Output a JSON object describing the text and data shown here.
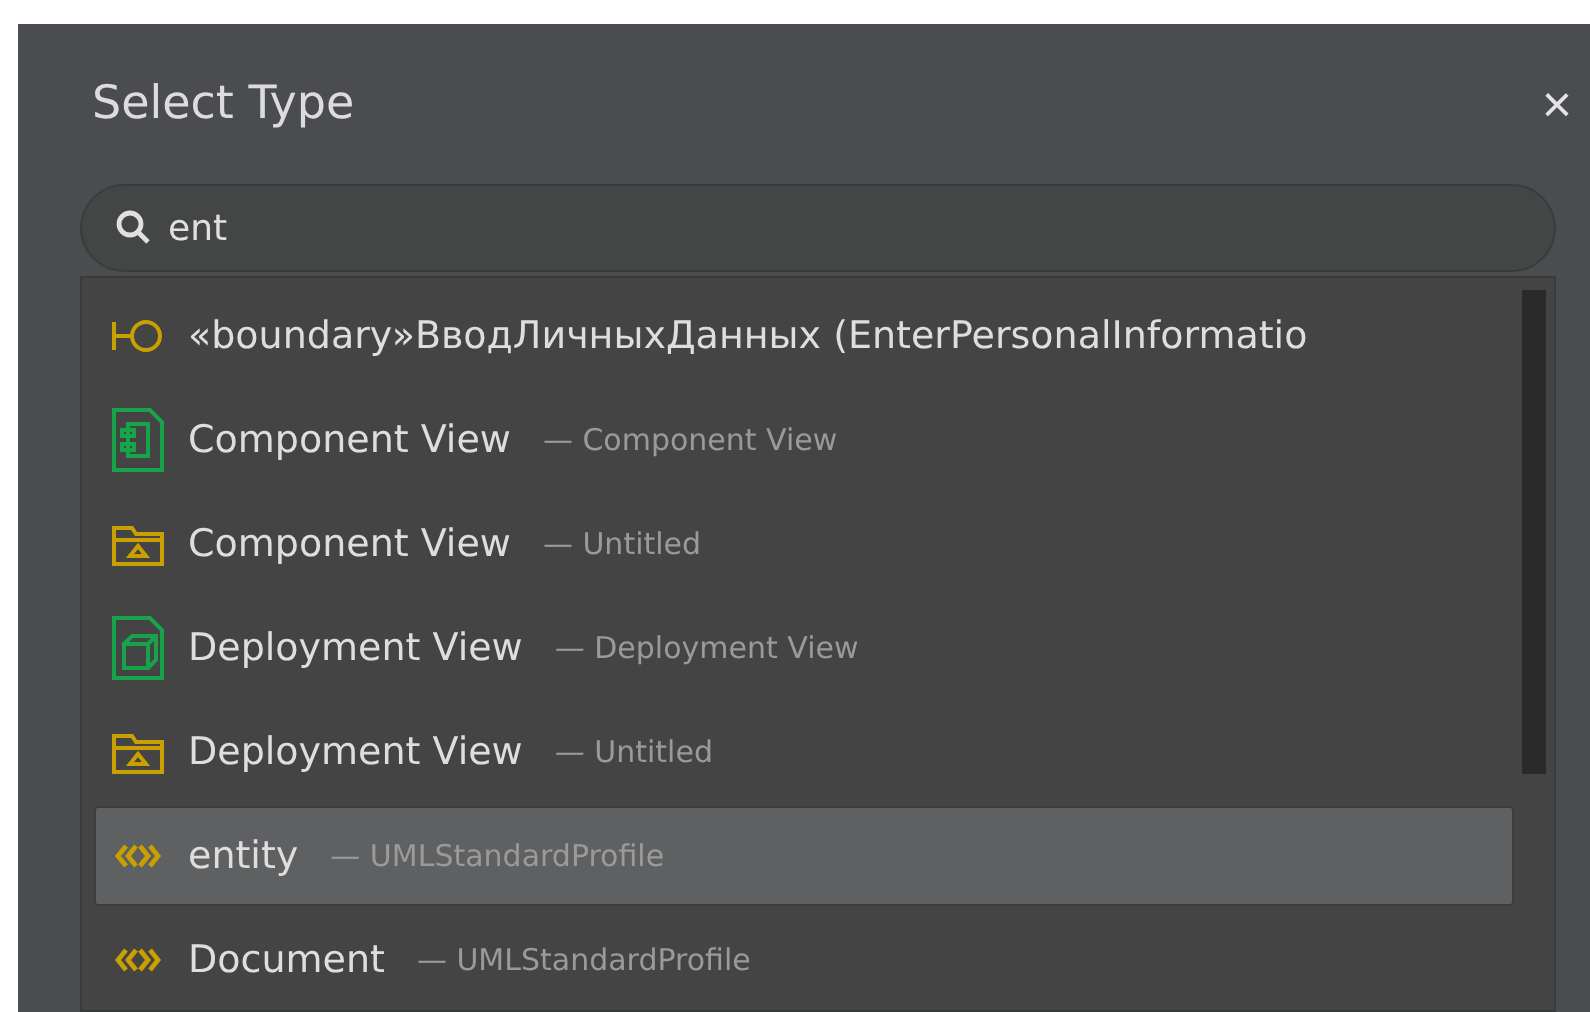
{
  "dialog": {
    "title": "Select Type",
    "close": "×"
  },
  "search": {
    "value": "ent"
  },
  "results": [
    {
      "kind": "boundary",
      "name": "«boundary»ВводЛичныхДанных (EnterPersonalInformatio",
      "selected": false
    },
    {
      "kind": "component-diagram",
      "name": "Component View",
      "detail": "— Component View",
      "selected": false
    },
    {
      "kind": "model",
      "name": "Component View",
      "detail": "— Untitled",
      "selected": false
    },
    {
      "kind": "deployment-diagram",
      "name": "Deployment View",
      "detail": "— Deployment View",
      "selected": false
    },
    {
      "kind": "model",
      "name": "Deployment View",
      "detail": "— Untitled",
      "selected": false
    },
    {
      "kind": "stereotype",
      "name": "entity",
      "detail": "— UMLStandardProfile",
      "selected": true
    },
    {
      "kind": "stereotype",
      "name": "Document",
      "detail": "— UMLStandardProfile",
      "selected": false
    }
  ]
}
